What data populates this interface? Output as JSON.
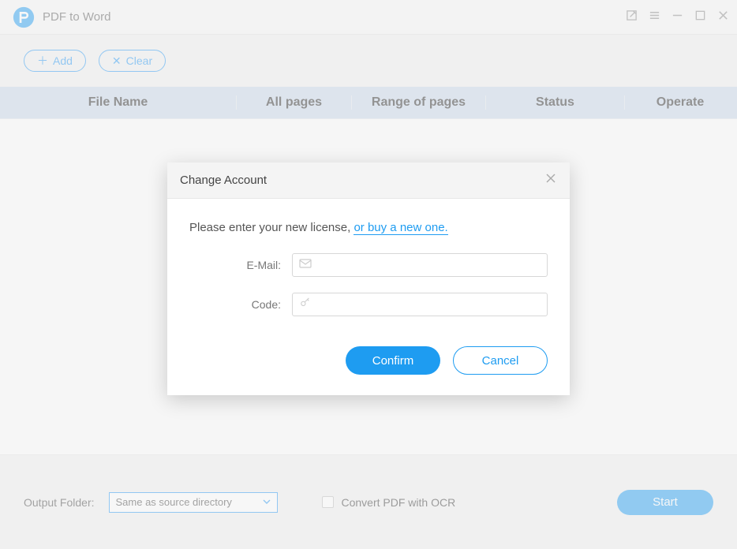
{
  "app": {
    "title": "PDF to Word"
  },
  "toolbar": {
    "add_label": "Add",
    "clear_label": "Clear"
  },
  "table": {
    "headers": {
      "filename": "File Name",
      "allpages": "All pages",
      "range": "Range of pages",
      "status": "Status",
      "operate": "Operate"
    }
  },
  "bottom": {
    "output_folder_label": "Output Folder:",
    "output_folder_value": "Same as source directory",
    "ocr_label": "Convert PDF with OCR",
    "start_label": "Start"
  },
  "modal": {
    "title": "Change Account",
    "prompt_prefix": "Please enter your new license, ",
    "prompt_link": "or buy a new one.",
    "email_label": "E-Mail:",
    "code_label": "Code:",
    "confirm_label": "Confirm",
    "cancel_label": "Cancel"
  }
}
